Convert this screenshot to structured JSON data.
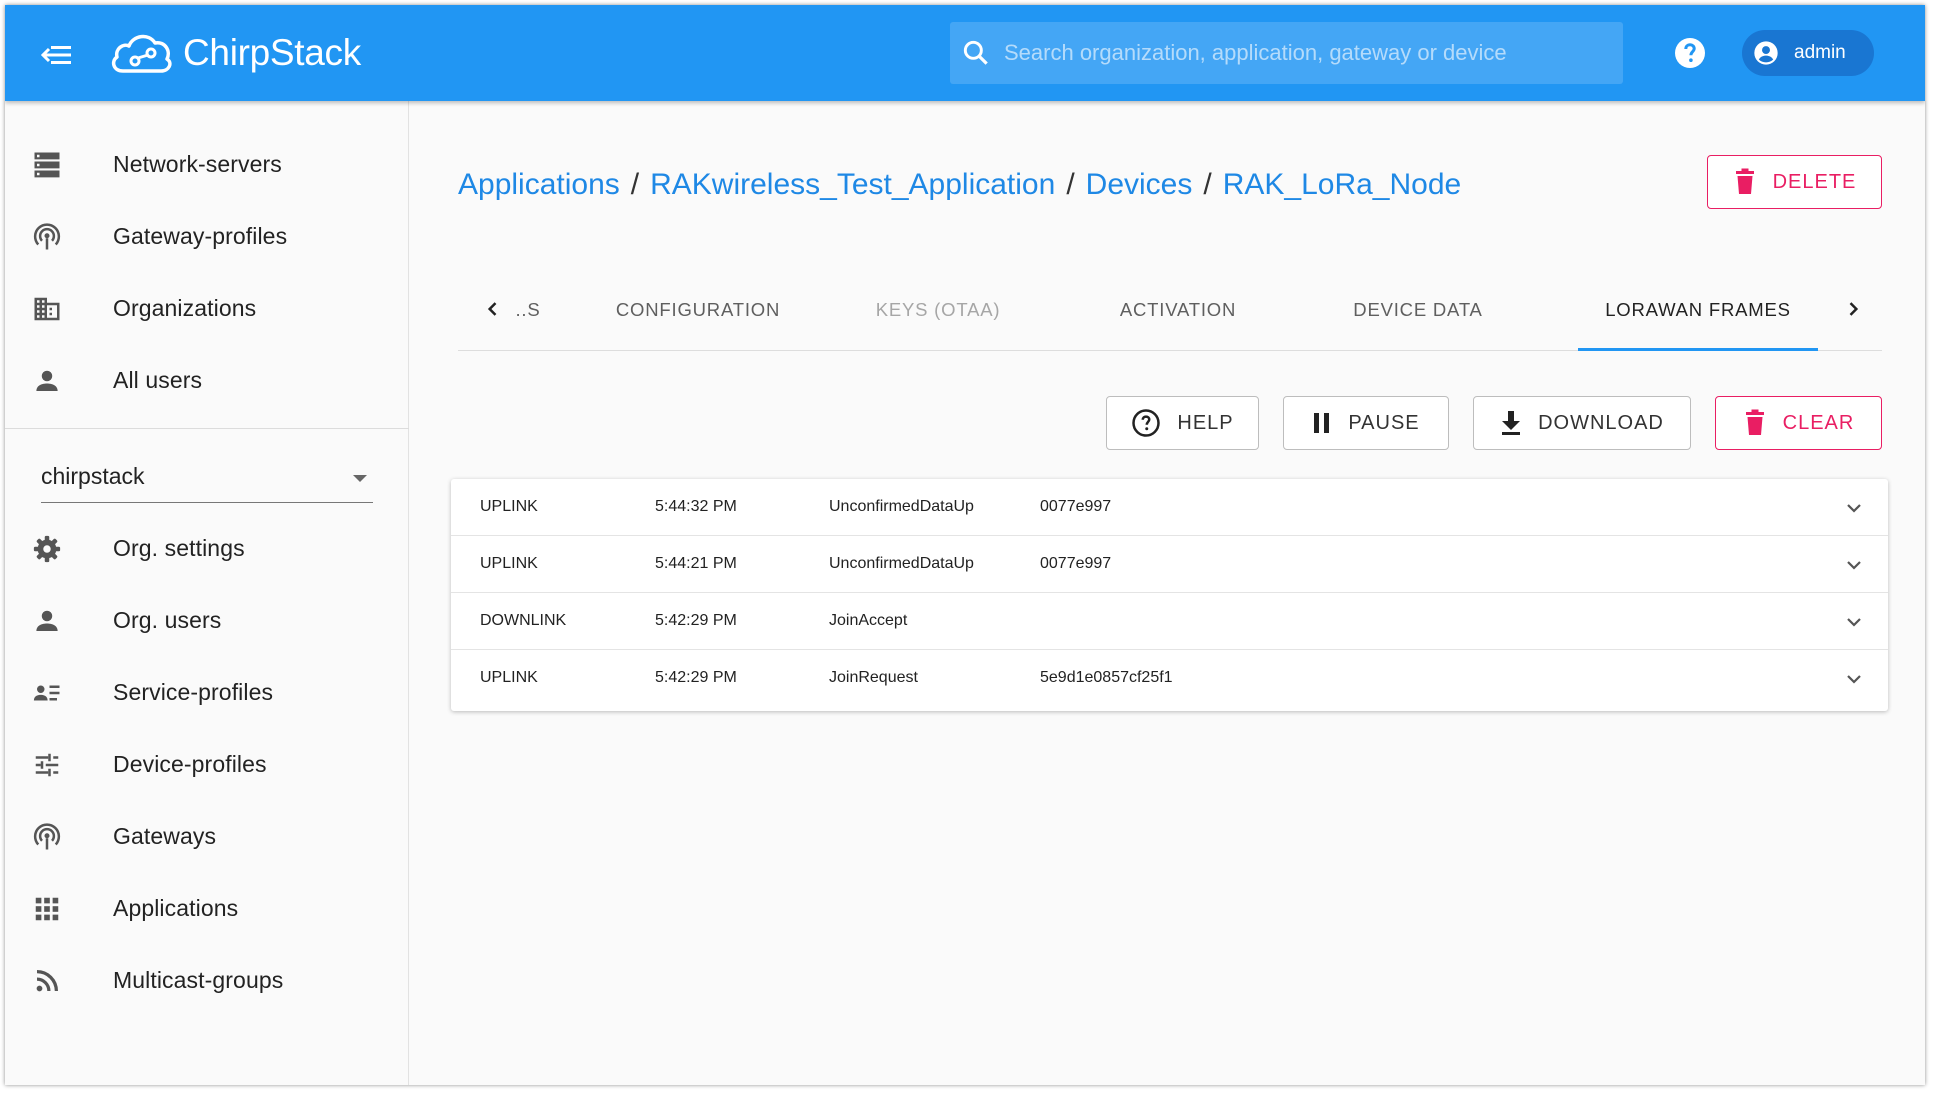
{
  "app": {
    "brand": "ChirpStack"
  },
  "header": {
    "search_placeholder": "Search organization, application, gateway or device",
    "user_name": "admin"
  },
  "sidebar": {
    "admin_items": [
      {
        "label": "Network-servers",
        "icon": "server-icon"
      },
      {
        "label": "Gateway-profiles",
        "icon": "antenna-icon"
      },
      {
        "label": "Organizations",
        "icon": "building-icon"
      },
      {
        "label": "All users",
        "icon": "person-icon"
      }
    ],
    "org_selector": {
      "value": "chirpstack"
    },
    "org_items": [
      {
        "label": "Org. settings",
        "icon": "gear-icon"
      },
      {
        "label": "Org. users",
        "icon": "person-icon"
      },
      {
        "label": "Service-profiles",
        "icon": "account-details-icon"
      },
      {
        "label": "Device-profiles",
        "icon": "tune-icon"
      },
      {
        "label": "Gateways",
        "icon": "antenna-icon"
      },
      {
        "label": "Applications",
        "icon": "apps-grid-icon"
      },
      {
        "label": "Multicast-groups",
        "icon": "rss-icon"
      }
    ]
  },
  "breadcrumb": {
    "items": [
      "Applications",
      "RAKwireless_Test_Application",
      "Devices",
      "RAK_LoRa_Node"
    ],
    "separator": "/"
  },
  "actions": {
    "delete_label": "DELETE"
  },
  "tabs": {
    "items": [
      {
        "label": "..S",
        "state": "normal"
      },
      {
        "label": "CONFIGURATION",
        "state": "normal"
      },
      {
        "label": "KEYS (OTAA)",
        "state": "disabled"
      },
      {
        "label": "ACTIVATION",
        "state": "normal"
      },
      {
        "label": "DEVICE DATA",
        "state": "normal"
      },
      {
        "label": "LORAWAN FRAMES",
        "state": "active"
      }
    ]
  },
  "toolbar": {
    "help_label": "HELP",
    "pause_label": "PAUSE",
    "download_label": "DOWNLOAD",
    "clear_label": "CLEAR"
  },
  "frames": [
    {
      "direction": "UPLINK",
      "time": "5:44:32 PM",
      "type": "UnconfirmedDataUp",
      "id": "0077e997"
    },
    {
      "direction": "UPLINK",
      "time": "5:44:21 PM",
      "type": "UnconfirmedDataUp",
      "id": "0077e997"
    },
    {
      "direction": "DOWNLINK",
      "time": "5:42:29 PM",
      "type": "JoinAccept",
      "id": ""
    },
    {
      "direction": "UPLINK",
      "time": "5:42:29 PM",
      "type": "JoinRequest",
      "id": "5e9d1e0857cf25f1"
    }
  ],
  "colors": {
    "primary": "#2196f3",
    "primary_dark": "#1976d2",
    "link": "#1e88e5",
    "danger": "#e91e63"
  }
}
